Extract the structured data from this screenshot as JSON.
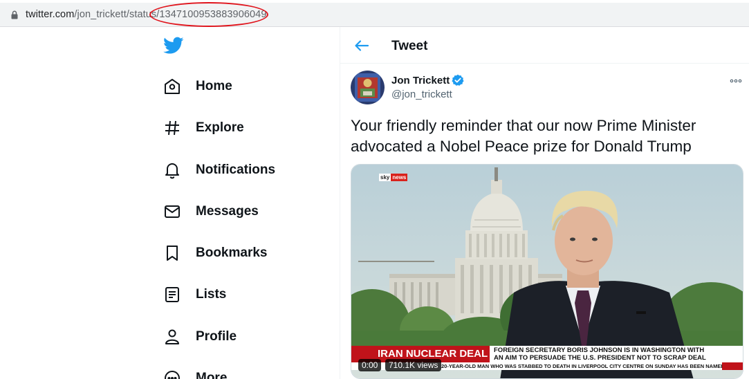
{
  "browser": {
    "url_host": "twitter.com",
    "url_path": "/jon_trickett/status/1347100953883906049"
  },
  "nav": {
    "items": [
      {
        "label": "Home"
      },
      {
        "label": "Explore"
      },
      {
        "label": "Notifications"
      },
      {
        "label": "Messages"
      },
      {
        "label": "Bookmarks"
      },
      {
        "label": "Lists"
      },
      {
        "label": "Profile"
      },
      {
        "label": "More"
      }
    ]
  },
  "header": {
    "title": "Tweet"
  },
  "tweet": {
    "author_name": "Jon Trickett",
    "author_handle": "@jon_trickett",
    "text": "Your friendly reminder that our now Prime Minister advocated a Nobel Peace prize for Donald Trump",
    "media": {
      "logo_left": "sky",
      "logo_right": "news",
      "headline": "IRAN NUCLEAR DEAL",
      "subline_1": "FOREIGN SECRETARY BORIS JOHNSON IS IN WASHINGTON WITH",
      "subline_2": "AN AIM TO PERSUADE THE U.S. PRESIDENT NOT TO SCRAP DEAL",
      "ticker": "20-YEAR-OLD MAN WHO WAS STABBED TO DEATH IN LIVERPOOL CITY CENTRE ON SUNDAY HAS BEEN NAMED (",
      "time": "0:00",
      "views": "710.1K views"
    }
  },
  "colors": {
    "twitter_blue": "#1d9bf0",
    "annotation_red": "#e0141c",
    "news_red": "#c0131a"
  }
}
